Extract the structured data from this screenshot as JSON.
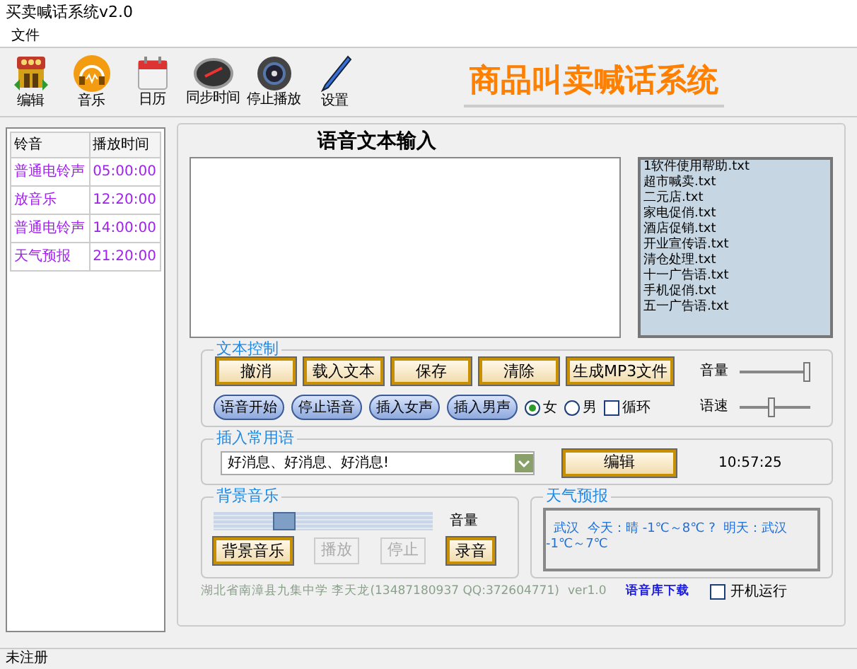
{
  "window": {
    "title": "买卖喊话系统v2.0"
  },
  "menu": [
    "文件"
  ],
  "toolbar": [
    {
      "label": "编辑",
      "kind": "shop"
    },
    {
      "label": "音乐",
      "kind": "headphones"
    },
    {
      "label": "日历",
      "kind": "calendar"
    },
    {
      "label": "同步时间",
      "kind": "gauge"
    },
    {
      "label": "停止播放",
      "kind": "stop"
    },
    {
      "label": "设置",
      "kind": "pen"
    }
  ],
  "banner": "商品叫卖喊话系统",
  "schedule": {
    "columns": [
      "铃音",
      "播放时间"
    ],
    "rows": [
      [
        "普通电铃声",
        "05:00:00"
      ],
      [
        "放音乐",
        "12:20:00"
      ],
      [
        "普通电铃声",
        "14:00:00"
      ],
      [
        "天气预报",
        "21:20:00"
      ]
    ]
  },
  "editor": {
    "title": "语音文本输入"
  },
  "files": [
    "1软件使用帮助.txt",
    "超市喊卖.txt",
    "二元店.txt",
    "家电促俏.txt",
    "酒店促销.txt",
    "开业宣传语.txt",
    "清仓处理.txt",
    "十一广告语.txt",
    "手机促俏.txt",
    "五一广告语.txt"
  ],
  "text_control": {
    "title": "文本控制",
    "buttons": [
      "撤消",
      "载入文本",
      "保存",
      "清除",
      "生成MP3文件"
    ],
    "voice_buttons": [
      "语音开始",
      "停止语音",
      "插入女声",
      "插入男声"
    ],
    "voices": [
      {
        "label": "女",
        "selected": true
      },
      {
        "label": "男",
        "selected": false
      }
    ],
    "loop": {
      "label": "循环",
      "checked": false
    },
    "sliders": [
      {
        "label": "音量",
        "level": 0.95
      },
      {
        "label": "语速",
        "level": 0.45
      }
    ]
  },
  "phrases": {
    "title": "插入常用语",
    "value": "好消息、好消息、好消息!",
    "button": "编辑",
    "time": "10:57:25"
  },
  "music": {
    "title": "背景音乐",
    "slider": {
      "label": "音量",
      "level": 0.3
    },
    "buttons": [
      {
        "label": "背景音乐",
        "disabled": false
      },
      {
        "label": "播放",
        "disabled": true
      },
      {
        "label": "停止",
        "disabled": true
      },
      {
        "label": "录音",
        "disabled": false
      }
    ]
  },
  "weather": {
    "title": "天气预报",
    "text": "  武汉  今天：晴 -1℃～8℃ ?  明天：武汉 -1℃～7℃"
  },
  "footer": {
    "author": "湖北省南漳县九集中学  李天龙(13487180937 QQ:372604771)",
    "version": "ver1.0",
    "link": "语音库下载",
    "autostart": {
      "label": "开机运行",
      "checked": false
    }
  },
  "status_bar": "未注册"
}
